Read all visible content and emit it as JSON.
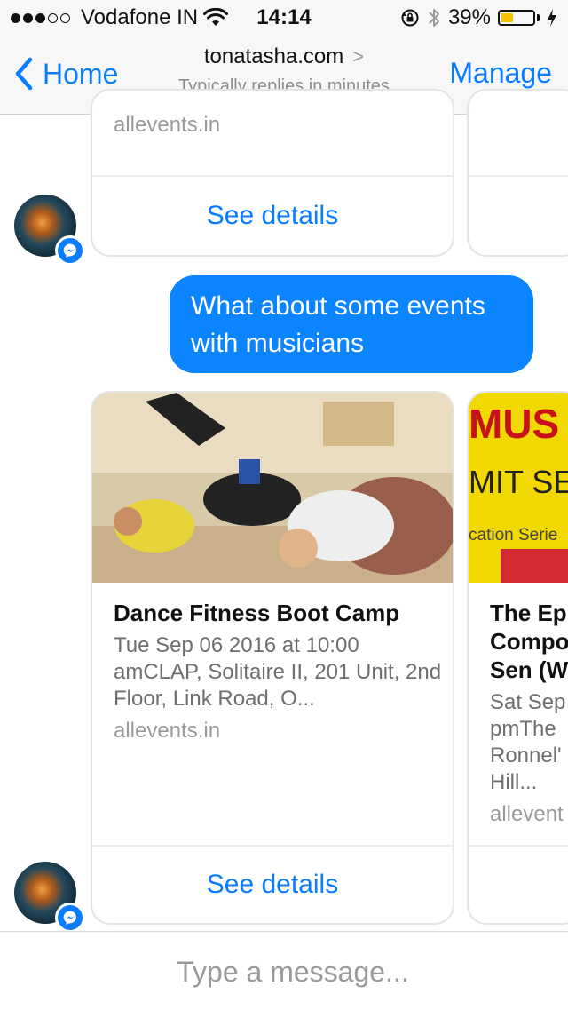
{
  "status_bar": {
    "carrier": "Vodafone IN",
    "time": "14:14",
    "battery_percent": "39%",
    "battery_level": 0.39,
    "signal_bars_filled": 3,
    "signal_bars_total": 5,
    "icons": [
      "wifi-icon",
      "orientation-lock-icon",
      "bluetooth-icon",
      "battery-icon",
      "charging-icon"
    ]
  },
  "nav": {
    "back_label": "Home",
    "title": "tonatasha.com",
    "title_chevron": ">",
    "subtitle": "Typically replies in minutes",
    "manage_label": "Manage"
  },
  "colors": {
    "accent": "#0a7cff",
    "bubble": "#0a84ff",
    "battery_fill": "#f5c400"
  },
  "previous_cards": {
    "left": {
      "domain": "allevents.in",
      "action_label": "See details"
    }
  },
  "user_message": {
    "text": "What about some events with musicians"
  },
  "event_cards": [
    {
      "title": "Dance Fitness Boot Camp",
      "subtitle": "Tue Sep 06 2016 at 10:00 amCLAP, Solitaire II, 201 Unit, 2nd Floor, Link Road, O...",
      "domain": "allevents.in",
      "action_label": "See details"
    },
    {
      "title": "The Ep Compo Sen (W",
      "image_text_1": "MUS",
      "image_text_2": "MIT SE",
      "image_text_3": "cation Serie",
      "subtitle": "Sat Sep pmThe Ronnel' Hill...",
      "domain": "allevent"
    }
  ],
  "composer": {
    "placeholder": "Type a message..."
  }
}
